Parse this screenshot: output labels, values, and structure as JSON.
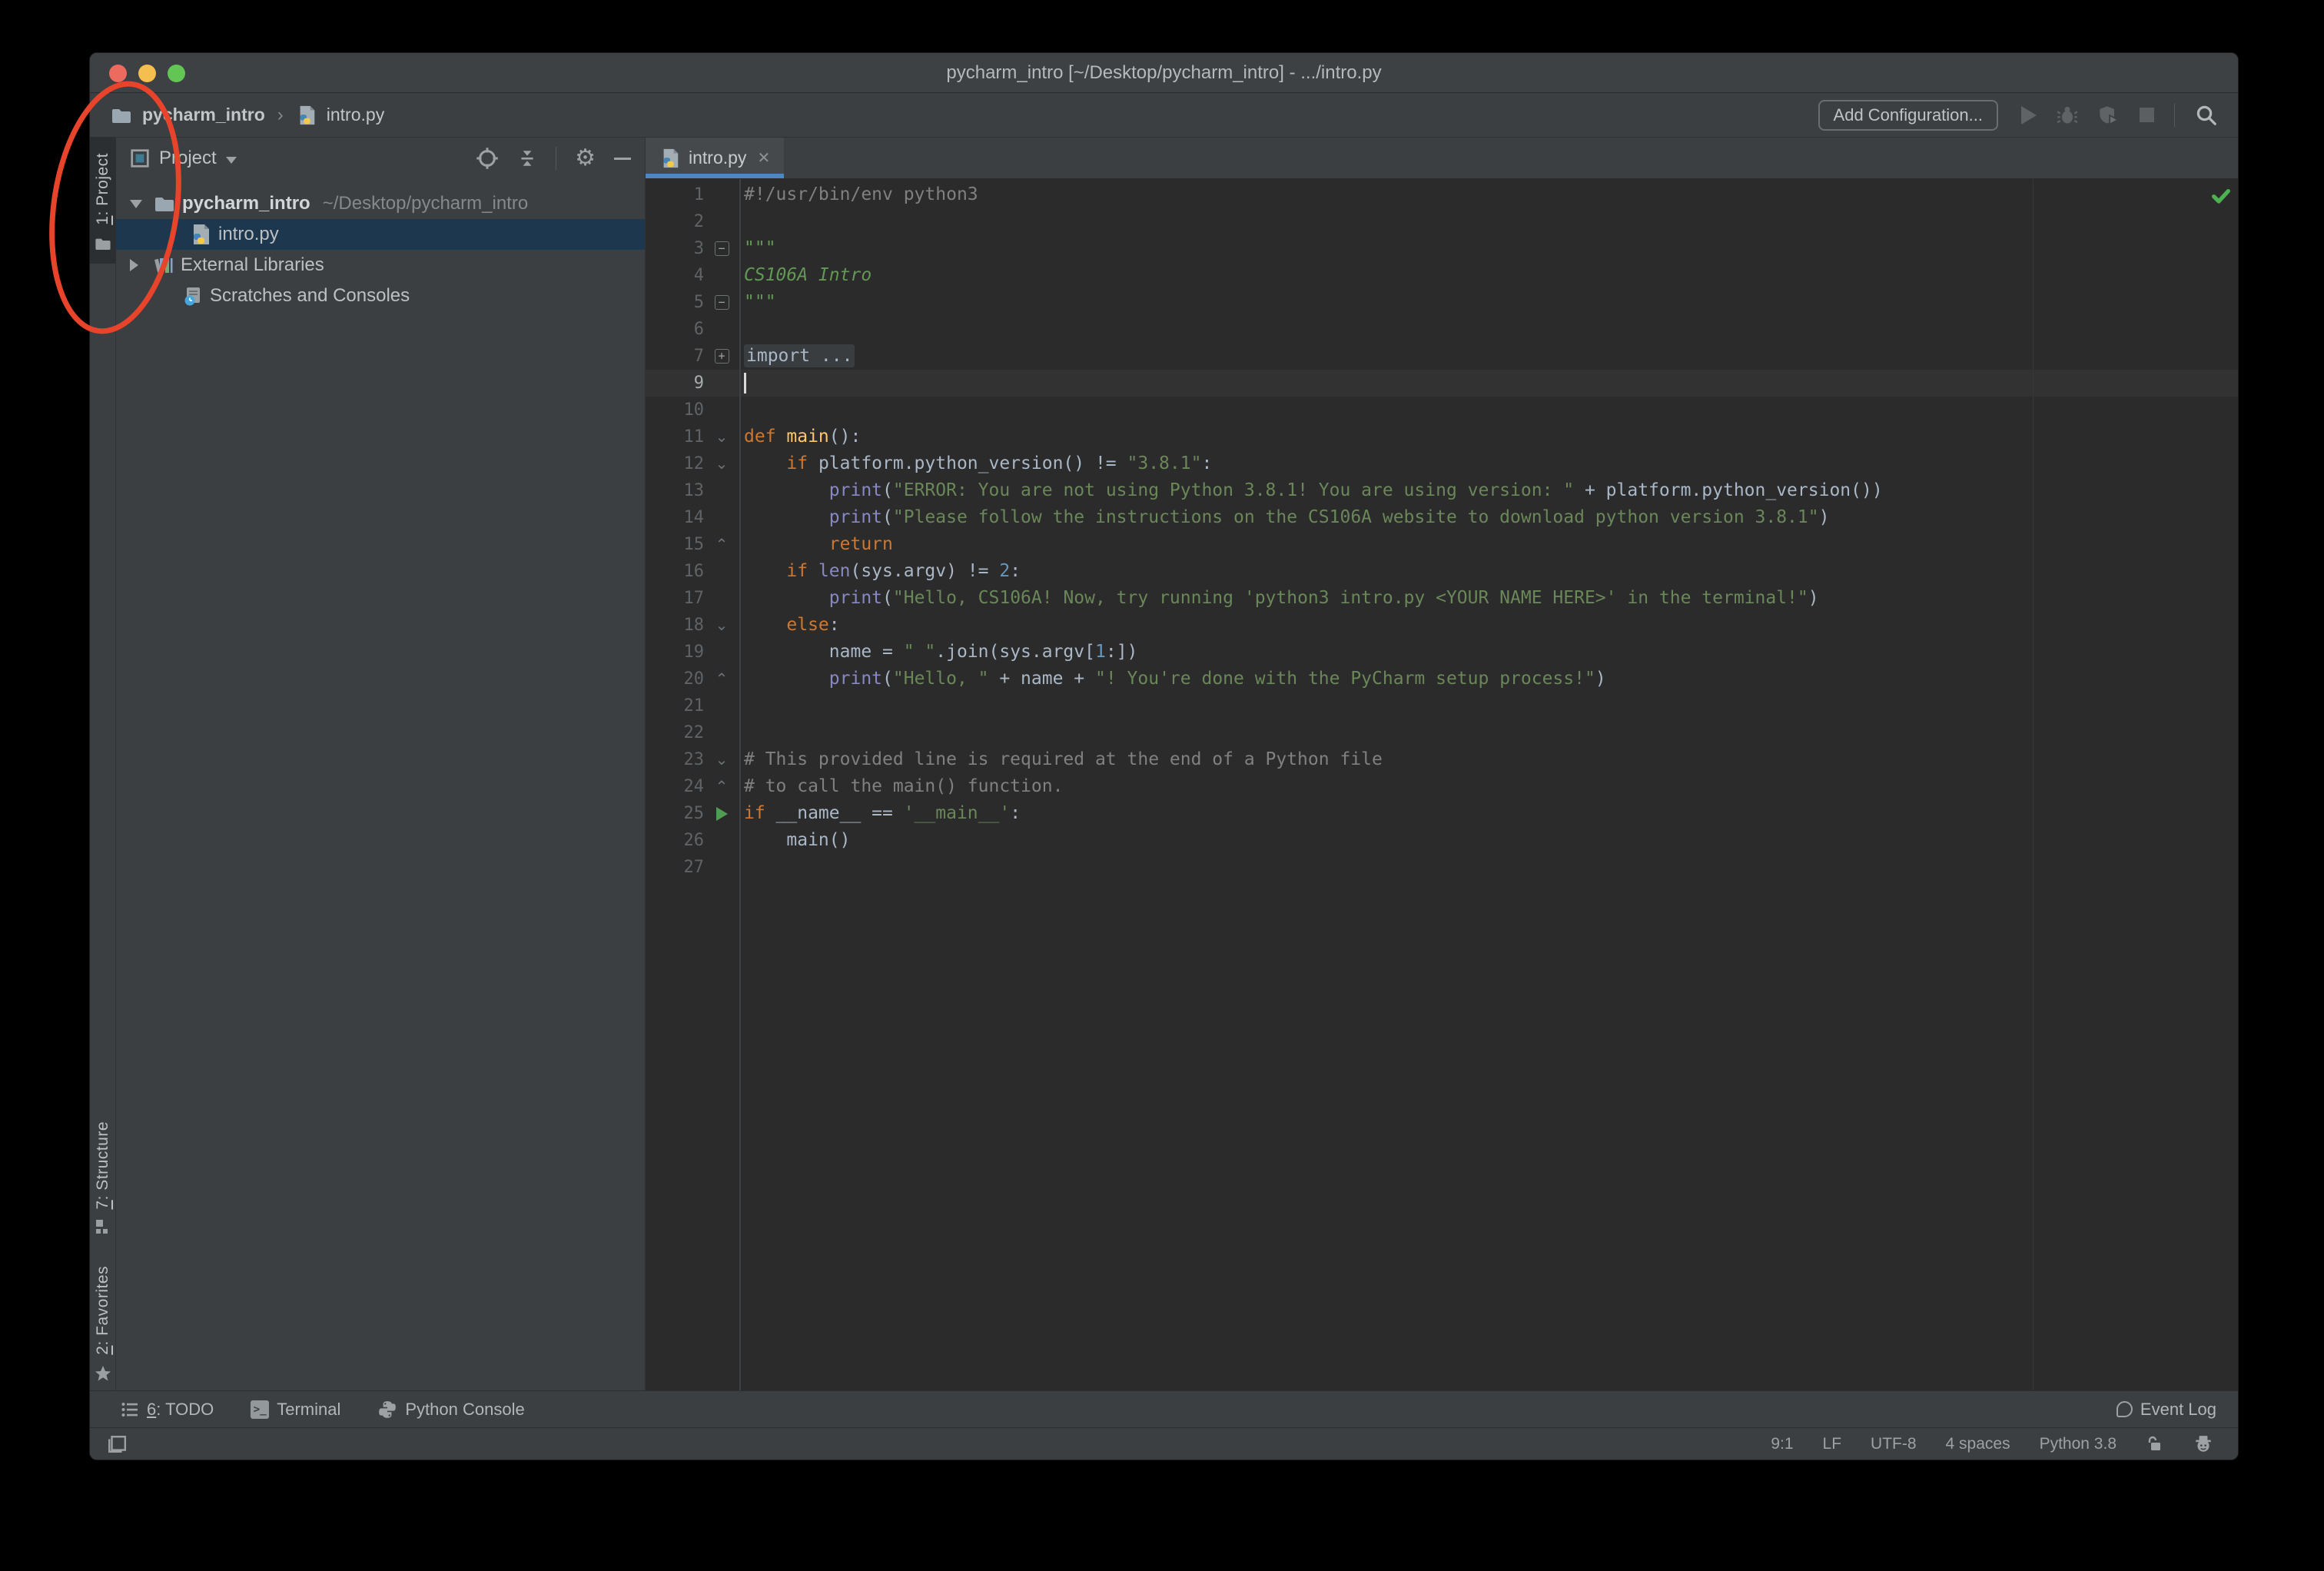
{
  "window": {
    "title": "pycharm_intro [~/Desktop/pycharm_intro] - .../intro.py",
    "traffic_lights": {
      "close": "#ec6a5e",
      "minimize": "#f5bf4f",
      "zoom": "#62c554"
    }
  },
  "navbar": {
    "breadcrumbs": {
      "project": "pycharm_intro",
      "file": "intro.py",
      "separator": "›"
    },
    "add_configuration_label": "Add Configuration...",
    "icons": [
      "run-icon",
      "debug-icon",
      "coverage-icon",
      "stop-icon",
      "search-icon"
    ]
  },
  "left_stripe": {
    "project": {
      "mn": "1",
      "rest": ": Project"
    },
    "structure": {
      "mn": "7",
      "rest": ": Structure"
    },
    "favorites": {
      "mn": "2",
      "rest": ": Favorites"
    }
  },
  "project_panel": {
    "title": "Project",
    "header_icons": [
      "locate-icon",
      "collapse-all-icon",
      "settings-gear-icon",
      "hide-icon"
    ],
    "tree": [
      {
        "label": "pycharm_intro",
        "path": "~/Desktop/pycharm_intro",
        "expanded": true
      },
      {
        "label": "intro.py",
        "selected": true
      },
      {
        "label": "External Libraries",
        "expanded": false
      },
      {
        "label": "Scratches and Consoles"
      }
    ]
  },
  "editor": {
    "tab_label": "intro.py",
    "all_inspections_ok": true,
    "lines": [
      {
        "n": "1",
        "t": [
          [
            "c",
            "#!/usr/bin/env python3"
          ]
        ]
      },
      {
        "n": "2",
        "t": []
      },
      {
        "n": "3",
        "g": "m",
        "t": [
          [
            "d",
            "\"\"\""
          ]
        ]
      },
      {
        "n": "4",
        "t": [
          [
            "di",
            "CS106A Intro"
          ]
        ]
      },
      {
        "n": "5",
        "g": "me",
        "t": [
          [
            "d",
            "\"\"\""
          ]
        ]
      },
      {
        "n": "6",
        "t": []
      },
      {
        "n": "7",
        "g": "p",
        "t": [
          [
            "fo",
            "import ..."
          ]
        ]
      },
      {
        "n": "9",
        "cur": true,
        "caret": true,
        "t": []
      },
      {
        "n": "10",
        "t": []
      },
      {
        "n": "11",
        "g": "o",
        "t": [
          [
            "k",
            "def "
          ],
          [
            "f",
            "main"
          ],
          [
            "p",
            "():"
          ]
        ]
      },
      {
        "n": "12",
        "g": "o",
        "t": [
          [
            "p",
            "    "
          ],
          [
            "k",
            "if "
          ],
          [
            "p",
            "platform.python_version() != "
          ],
          [
            "s",
            "\"3.8.1\""
          ],
          [
            "p",
            ":"
          ]
        ]
      },
      {
        "n": "13",
        "t": [
          [
            "p",
            "        "
          ],
          [
            "b",
            "print"
          ],
          [
            "p",
            "("
          ],
          [
            "s",
            "\"ERROR: You are not using Python 3.8.1! You are using version: \""
          ],
          [
            "p",
            " + platform.python_version())"
          ]
        ]
      },
      {
        "n": "14",
        "t": [
          [
            "p",
            "        "
          ],
          [
            "b",
            "print"
          ],
          [
            "p",
            "("
          ],
          [
            "s",
            "\"Please follow the instructions on the CS106A website to download python version 3.8.1\""
          ],
          [
            "p",
            ")"
          ]
        ]
      },
      {
        "n": "15",
        "g": "e",
        "t": [
          [
            "p",
            "        "
          ],
          [
            "k",
            "return"
          ]
        ]
      },
      {
        "n": "16",
        "t": [
          [
            "p",
            "    "
          ],
          [
            "k",
            "if "
          ],
          [
            "b",
            "len"
          ],
          [
            "p",
            "(sys.argv) != "
          ],
          [
            "n2",
            "2"
          ],
          [
            "p",
            ":"
          ]
        ]
      },
      {
        "n": "17",
        "t": [
          [
            "p",
            "        "
          ],
          [
            "b",
            "print"
          ],
          [
            "p",
            "("
          ],
          [
            "s",
            "\"Hello, CS106A! Now, try running 'python3 intro.py <YOUR NAME HERE>' in the terminal!\""
          ],
          [
            "p",
            ")"
          ]
        ]
      },
      {
        "n": "18",
        "g": "o",
        "t": [
          [
            "p",
            "    "
          ],
          [
            "k",
            "else"
          ],
          [
            "p",
            ":"
          ]
        ]
      },
      {
        "n": "19",
        "t": [
          [
            "p",
            "        name = "
          ],
          [
            "s",
            "\" \""
          ],
          [
            "p",
            ".join(sys.argv["
          ],
          [
            "n2",
            "1"
          ],
          [
            "p",
            ":])"
          ]
        ]
      },
      {
        "n": "20",
        "g": "e",
        "t": [
          [
            "p",
            "        "
          ],
          [
            "b",
            "print"
          ],
          [
            "p",
            "("
          ],
          [
            "s",
            "\"Hello, \""
          ],
          [
            "p",
            " + name + "
          ],
          [
            "s",
            "\"! You're done with the PyCharm setup process!\""
          ],
          [
            "p",
            ")"
          ]
        ]
      },
      {
        "n": "21",
        "t": []
      },
      {
        "n": "22",
        "t": []
      },
      {
        "n": "23",
        "g": "o",
        "t": [
          [
            "c",
            "# This provided line is required at the end of a Python file"
          ]
        ]
      },
      {
        "n": "24",
        "g": "e",
        "t": [
          [
            "c",
            "# to call the main() function."
          ]
        ]
      },
      {
        "n": "25",
        "g": "r",
        "t": [
          [
            "k",
            "if "
          ],
          [
            "p",
            "__name__ == "
          ],
          [
            "s",
            "'__main__'"
          ],
          [
            "p",
            ":"
          ]
        ]
      },
      {
        "n": "26",
        "t": [
          [
            "p",
            "    main()"
          ]
        ]
      },
      {
        "n": "27",
        "t": []
      }
    ]
  },
  "bottom_bar": {
    "todo": {
      "mn": "6",
      "rest": ": TODO"
    },
    "terminal": "Terminal",
    "python_console": "Python Console",
    "event_log": "Event Log"
  },
  "status_bar": {
    "caret_position": "9:1",
    "line_ending": "LF",
    "encoding": "UTF-8",
    "indent": "4 spaces",
    "interpreter": "Python 3.8"
  },
  "colors": {
    "editor_background": "#2b2b2b",
    "panel_background": "#3c3f41",
    "tab_accent": "#4a88c7",
    "selection": "#1c374e",
    "keyword": "#cc7832",
    "string": "#6a8759",
    "number": "#6897bb",
    "comment": "#808080",
    "docstring": "#629755",
    "annotation_red": "#e8432b",
    "check_green": "#4db151"
  },
  "annotation": {
    "shape": "ellipse",
    "color": "#e8432b",
    "target": "project-tool-button"
  }
}
